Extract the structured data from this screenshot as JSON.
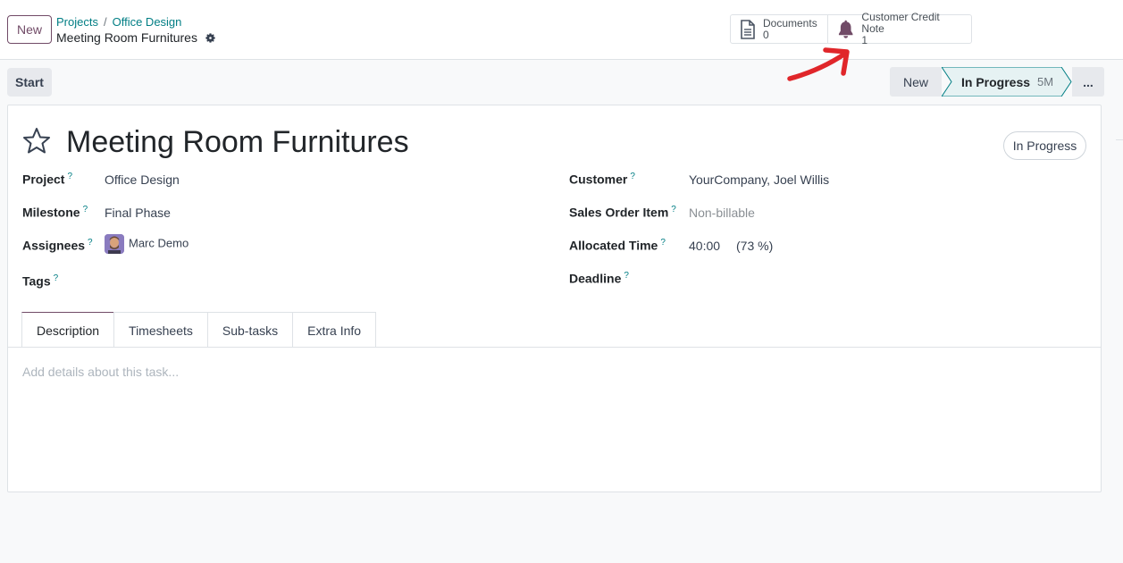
{
  "control_panel": {
    "new_label": "New",
    "breadcrumb": [
      "Projects",
      "Office Design"
    ],
    "separator": "/",
    "record_title": "Meeting Room Furnitures",
    "smart_buttons": [
      {
        "label": "Documents",
        "value": "0",
        "icon": "document-icon"
      },
      {
        "label": "Customer Credit Note",
        "value": "1",
        "icon": "bell-icon"
      }
    ]
  },
  "statusbar": {
    "start_label": "Start",
    "stages": [
      {
        "label": "New"
      },
      {
        "label": "In Progress",
        "duration": "5M",
        "active": true
      }
    ],
    "more_label": "..."
  },
  "form": {
    "title": "Meeting Room Furnitures",
    "status": "In Progress",
    "help_mark": "?",
    "left_fields": [
      {
        "label": "Project",
        "value": "Office Design"
      },
      {
        "label": "Milestone",
        "value": "Final Phase"
      },
      {
        "label": "Assignees",
        "value": "Marc Demo"
      },
      {
        "label": "Tags",
        "value": ""
      }
    ],
    "right_fields": [
      {
        "label": "Customer",
        "value": "YourCompany, Joel Willis"
      },
      {
        "label": "Sales Order Item",
        "value": "Non-billable"
      },
      {
        "label": "Allocated Time",
        "value": "40:00",
        "extra": "(73 %)"
      },
      {
        "label": "Deadline",
        "value": ""
      }
    ],
    "tabs": [
      "Description",
      "Timesheets",
      "Sub-tasks",
      "Extra Info"
    ],
    "description_placeholder": "Add details about this task..."
  },
  "colors": {
    "brand": "#714b67",
    "link": "#017e84",
    "annotation_arrow": "#e0262a"
  }
}
